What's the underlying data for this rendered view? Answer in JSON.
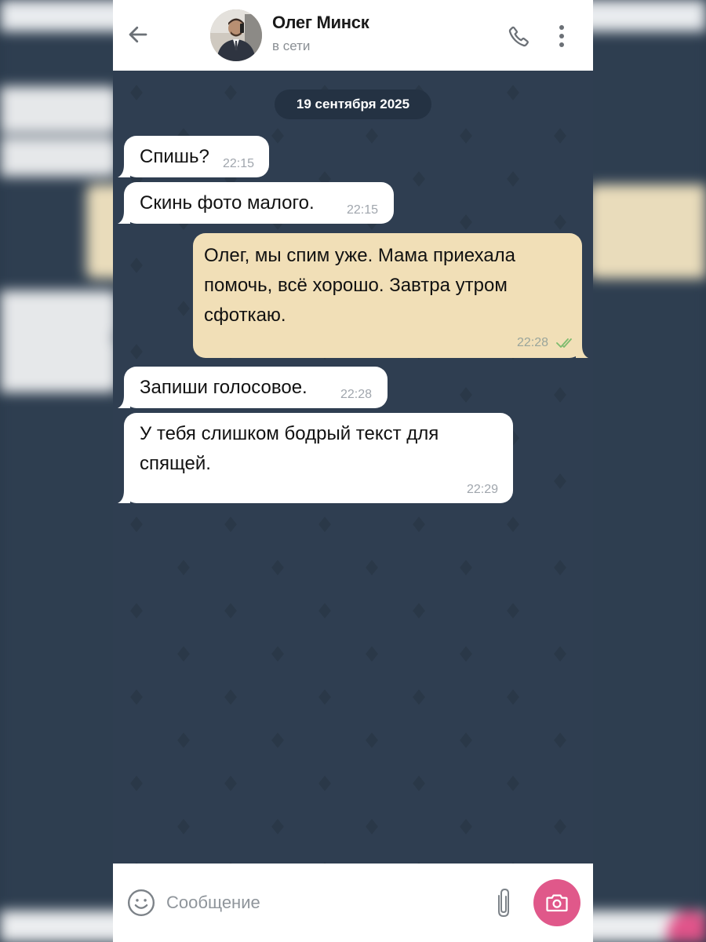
{
  "header": {
    "contact_name": "Олег Минск",
    "status": "в сети",
    "icons": {
      "back": "arrow-left-icon",
      "call": "phone-icon",
      "menu": "more-vertical-icon"
    }
  },
  "chat": {
    "date": "19 сентября 2025",
    "messages": [
      {
        "direction": "in",
        "text": "Спишь?",
        "time": "22:15"
      },
      {
        "direction": "in",
        "text": "Скинь фото малого.",
        "time": "22:15"
      },
      {
        "direction": "out",
        "text": "Олег, мы спим уже. Мама приехала помочь, всё хорошо. Завтра утром сфоткаю.",
        "time": "22:28",
        "read": true
      },
      {
        "direction": "in",
        "text": "Запиши голосовое.",
        "time": "22:28"
      },
      {
        "direction": "in",
        "text": "У тебя слишком бодрый текст для спящей.",
        "time": "22:29"
      }
    ]
  },
  "composer": {
    "placeholder": "Сообщение",
    "value": "",
    "icons": {
      "emoji": "smiley-icon",
      "attach": "paperclip-icon",
      "camera": "camera-icon"
    }
  },
  "colors": {
    "chat_bg": "#2f3e51",
    "incoming_bubble": "#ffffff",
    "outgoing_bubble": "#f1dfb7",
    "accent": "#e0588a",
    "read_check": "#7dbb6e"
  }
}
